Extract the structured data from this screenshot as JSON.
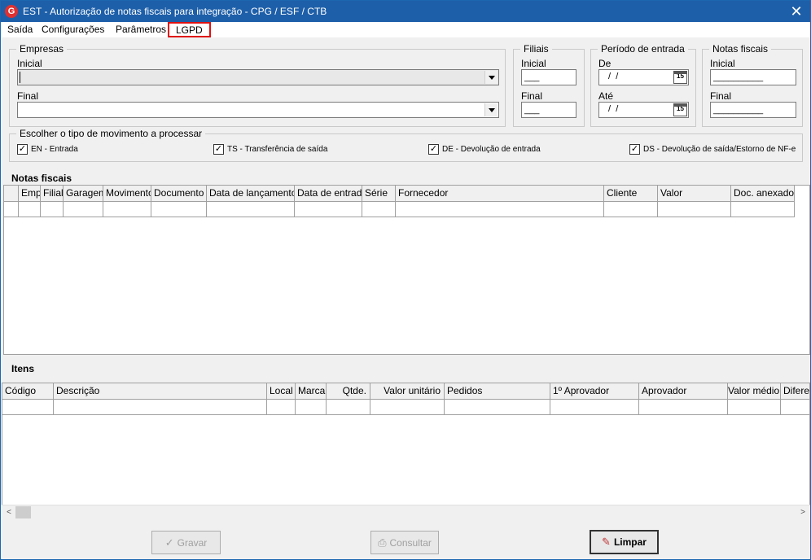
{
  "window": {
    "title": "EST - Autorização de notas fiscais para integração - CPG / ESF / CTB",
    "app_icon": "G",
    "close_glyph": "✕"
  },
  "menu": [
    {
      "label": "Saída"
    },
    {
      "label": "Configurações"
    },
    {
      "label": "Parâmetros"
    },
    {
      "label": "LGPD"
    }
  ],
  "empresas": {
    "legend": "Empresas",
    "inicial_label": "Inicial",
    "final_label": "Final"
  },
  "filiais": {
    "legend": "Filiais",
    "inicial_label": "Inicial",
    "inicial_value": "___",
    "final_label": "Final",
    "final_value": "___"
  },
  "periodo": {
    "legend": "Período de entrada",
    "de_label": "De",
    "de_value": " /  /",
    "ate_label": "Até",
    "ate_value": " /  /",
    "calendar_icon_text": "15"
  },
  "notas_filtro": {
    "legend": "Notas fiscais",
    "inicial_label": "Inicial",
    "inicial_value": "__________",
    "final_label": "Final",
    "final_value": "__________"
  },
  "movimento": {
    "legend": "Escolher o tipo de movimento a processar",
    "options": [
      {
        "label": "EN - Entrada",
        "checked": true
      },
      {
        "label": "TS - Transferência de saída",
        "checked": true
      },
      {
        "label": "DE - Devolução de entrada",
        "checked": true
      },
      {
        "label": "DS - Devolução de saída/Estorno de NF-e",
        "checked": true
      }
    ],
    "check_glyph": "✓"
  },
  "notas_grid": {
    "title": "Notas fiscais",
    "columns": [
      "",
      "Emp",
      "Filial",
      "Garagem",
      "Movimento",
      "Documento",
      "Data de lançamento",
      "Data de entrada",
      "Série",
      "Fornecedor",
      "Cliente",
      "Valor",
      "Doc. anexados"
    ]
  },
  "itens_grid": {
    "title": "Itens",
    "columns": [
      "Código",
      "Descrição",
      "Local",
      "Marca",
      "Qtde.",
      "Valor unitário",
      "Pedidos",
      "1º Aprovador",
      "Aprovador",
      "Valor médio",
      "Diferen"
    ]
  },
  "scrollbar": {
    "left_arrow": "<",
    "right_arrow": ">"
  },
  "buttons": {
    "gravar": {
      "label": "Gravar",
      "icon": "checkmark-icon",
      "glyph": "✓"
    },
    "consultar": {
      "label": "Consultar",
      "icon": "printer-icon",
      "glyph": "⎙"
    },
    "limpar": {
      "label": "Limpar",
      "icon": "broom-icon",
      "glyph": "✎"
    }
  }
}
